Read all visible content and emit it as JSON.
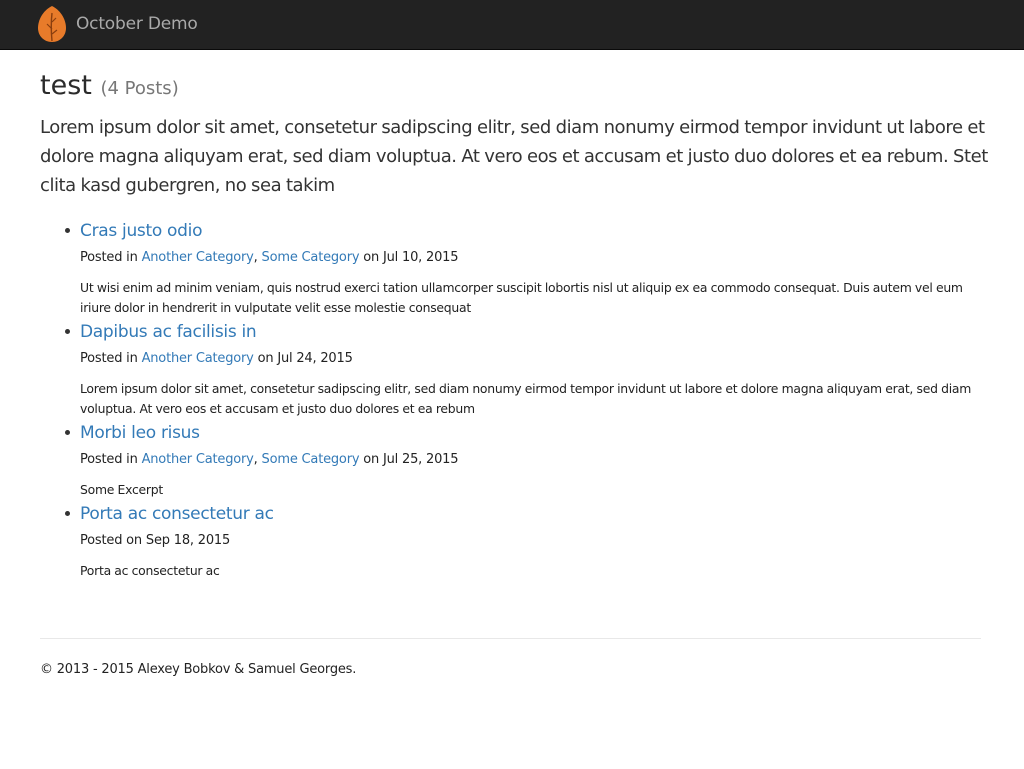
{
  "nav": {
    "brand": "October Demo",
    "logo_icon": "october-leaf-icon",
    "logo_color": "#e87b2a"
  },
  "category": {
    "name": "test",
    "count_text": "(4 Posts)",
    "description": "Lorem ipsum dolor sit amet, consetetur sadipscing elitr, sed diam nonumy eirmod tempor invidunt ut labore et dolore magna aliquyam erat, sed diam voluptua. At vero eos et accusam et justo duo dolores et ea rebum. Stet clita kasd gubergren, no sea takim"
  },
  "posts": [
    {
      "title": "Cras justo odio",
      "posted_in": "Posted in ",
      "categories": [
        "Another Category",
        "Some Category"
      ],
      "separator": ", ",
      "date_text": " on Jul 10, 2015",
      "excerpt": "Ut wisi enim ad minim veniam, quis nostrud exerci tation ullamcorper suscipit lobortis nisl ut aliquip ex ea commodo consequat. Duis autem vel eum iriure dolor in hendrerit in vulputate velit esse molestie consequat"
    },
    {
      "title": "Dapibus ac facilisis in",
      "posted_in": "Posted in ",
      "categories": [
        "Another Category"
      ],
      "separator": "",
      "date_text": " on Jul 24, 2015",
      "excerpt": "Lorem ipsum dolor sit amet, consetetur sadipscing elitr, sed diam nonumy eirmod tempor invidunt ut labore et dolore magna aliquyam erat, sed diam voluptua. At vero eos et accusam et justo duo dolores et ea rebum"
    },
    {
      "title": "Morbi leo risus",
      "posted_in": "Posted in ",
      "categories": [
        "Another Category",
        "Some Category"
      ],
      "separator": ", ",
      "date_text": " on Jul 25, 2015",
      "excerpt": "Some Excerpt"
    },
    {
      "title": "Porta ac consectetur ac",
      "posted_in": "Posted",
      "categories": [],
      "separator": "",
      "date_text": " on Sep 18, 2015",
      "excerpt": "Porta ac consectetur ac"
    }
  ],
  "footer": {
    "copyright": "© 2013 - 2015 Alexey Bobkov & Samuel Georges."
  },
  "colors": {
    "navbar": "#222222",
    "link": "#337ab7",
    "brand_text": "#a9a9a9"
  }
}
